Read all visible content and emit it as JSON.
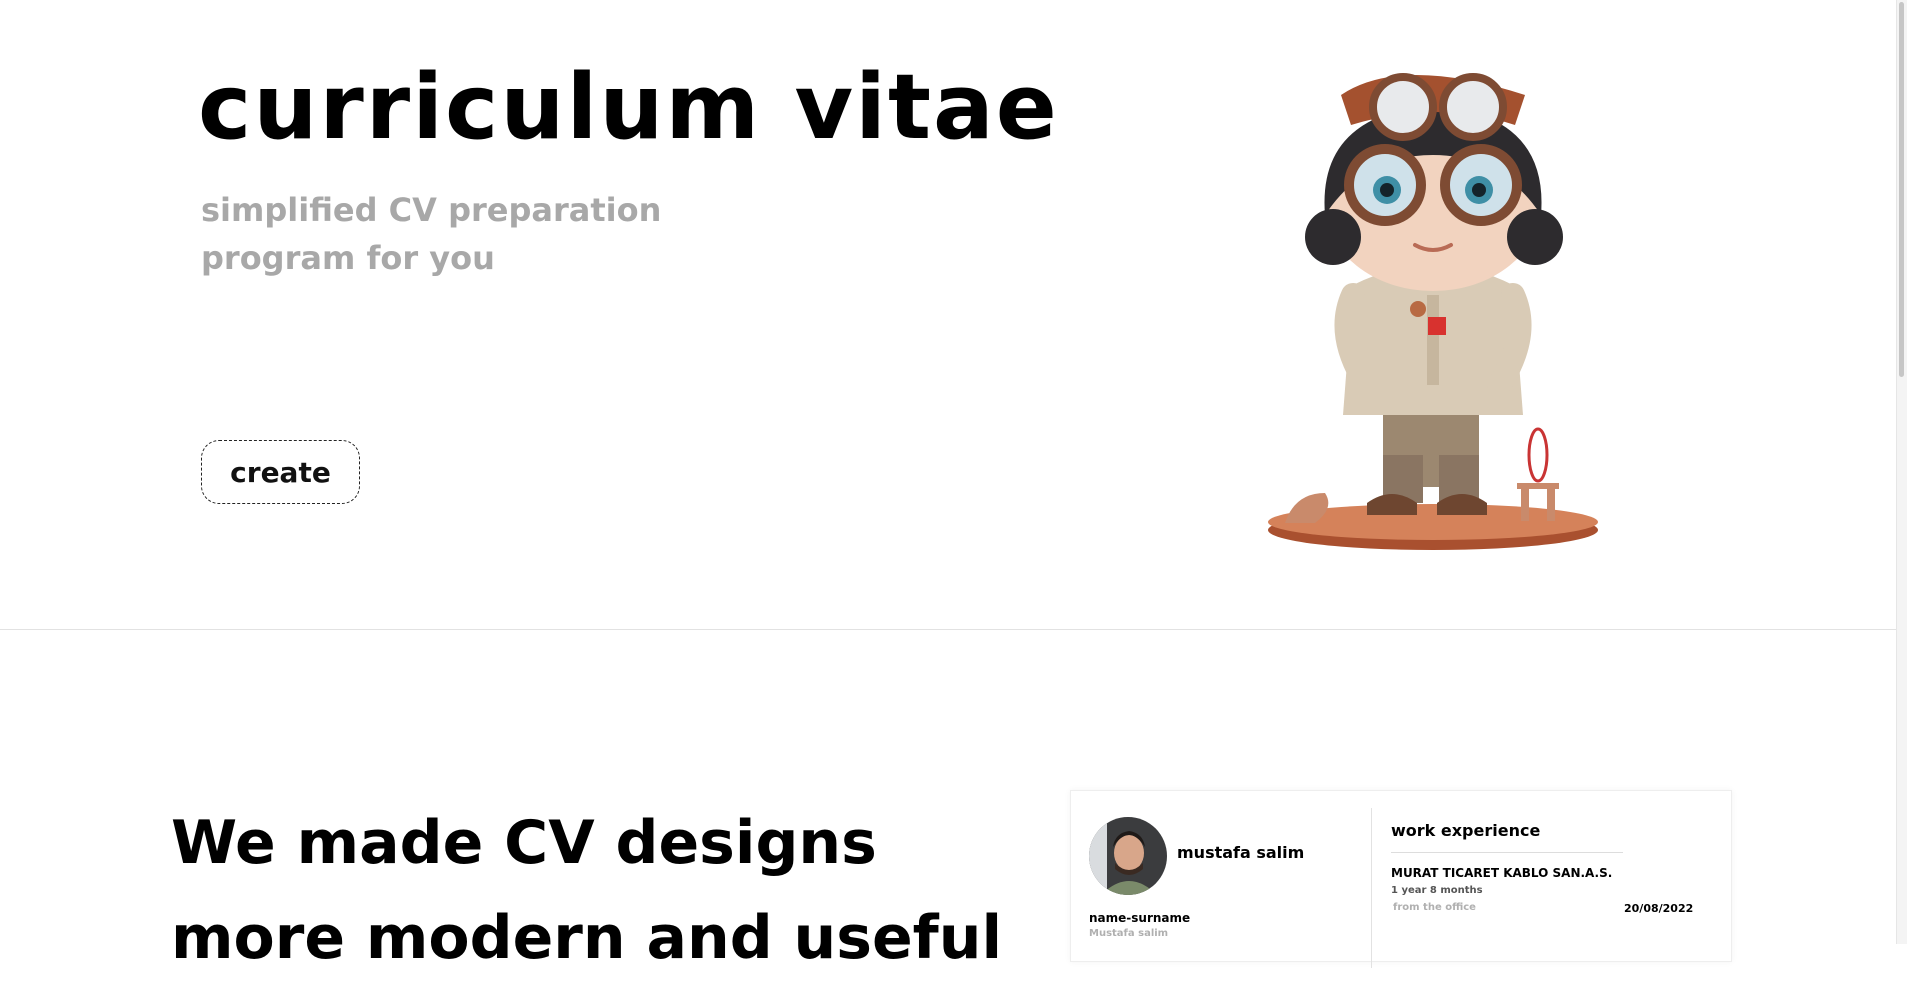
{
  "hero": {
    "title": "curriculum vitae",
    "subtitle": "simplified CV preparation program for you",
    "create_button": "create"
  },
  "section": {
    "title_line1": "We made CV designs",
    "title_line2": "more modern and useful"
  },
  "cv_preview": {
    "name": "mustafa salim",
    "field_label": "name-surname",
    "field_value": "Mustafa salim",
    "work_title": "work experience",
    "company": "MURAT TICARET KABLO SAN.A.S.",
    "duration": "1 year 8 months",
    "location": "from the office",
    "date": "20/08/2022"
  },
  "colors": {
    "subtitle": "#a8a8a8",
    "accent": "#b5573a"
  },
  "icons": {
    "illustration": "girl-aviator-figure",
    "avatar": "profile-photo"
  }
}
